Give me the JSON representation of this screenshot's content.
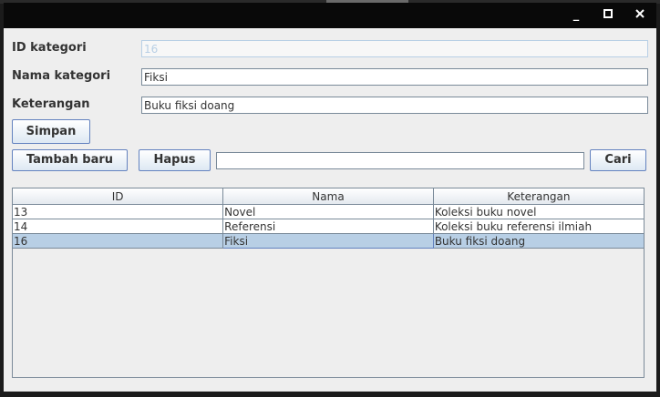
{
  "window": {
    "title": "",
    "controls": {
      "minimize": "_",
      "maximize": "□",
      "close": "✕"
    }
  },
  "form": {
    "id_label": "ID kategori",
    "id_value": "16",
    "name_label": "Nama kategori",
    "name_value": "Fiksi",
    "desc_label": "Keterangan",
    "desc_value": "Buku fiksi doang"
  },
  "buttons": {
    "save": "Simpan",
    "add_new": "Tambah baru",
    "delete": "Hapus",
    "search": "Cari"
  },
  "search": {
    "value": ""
  },
  "table": {
    "columns": [
      "ID",
      "Nama",
      "Keterangan"
    ],
    "rows": [
      {
        "id": "13",
        "nama": "Novel",
        "keterangan": "Koleksi buku novel"
      },
      {
        "id": "14",
        "nama": "Referensi",
        "keterangan": "Koleksi buku referensi ilmiah"
      },
      {
        "id": "16",
        "nama": "Fiksi",
        "keterangan": "Buku fiksi doang"
      }
    ],
    "selected_row": 2
  },
  "colors": {
    "selection": "#b8cfe5",
    "button_border": "#6382bf",
    "panel_bg": "#eeeeee"
  }
}
